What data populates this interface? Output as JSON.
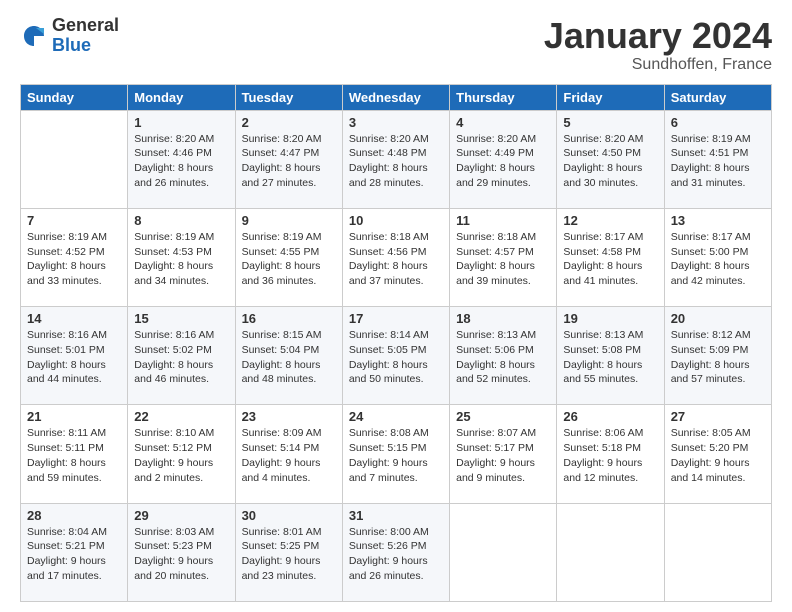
{
  "header": {
    "logo_general": "General",
    "logo_blue": "Blue",
    "title": "January 2024",
    "subtitle": "Sundhoffen, France"
  },
  "weekdays": [
    "Sunday",
    "Monday",
    "Tuesday",
    "Wednesday",
    "Thursday",
    "Friday",
    "Saturday"
  ],
  "weeks": [
    [
      {
        "day": "",
        "sunrise": "",
        "sunset": "",
        "daylight": ""
      },
      {
        "day": "1",
        "sunrise": "Sunrise: 8:20 AM",
        "sunset": "Sunset: 4:46 PM",
        "daylight": "Daylight: 8 hours and 26 minutes."
      },
      {
        "day": "2",
        "sunrise": "Sunrise: 8:20 AM",
        "sunset": "Sunset: 4:47 PM",
        "daylight": "Daylight: 8 hours and 27 minutes."
      },
      {
        "day": "3",
        "sunrise": "Sunrise: 8:20 AM",
        "sunset": "Sunset: 4:48 PM",
        "daylight": "Daylight: 8 hours and 28 minutes."
      },
      {
        "day": "4",
        "sunrise": "Sunrise: 8:20 AM",
        "sunset": "Sunset: 4:49 PM",
        "daylight": "Daylight: 8 hours and 29 minutes."
      },
      {
        "day": "5",
        "sunrise": "Sunrise: 8:20 AM",
        "sunset": "Sunset: 4:50 PM",
        "daylight": "Daylight: 8 hours and 30 minutes."
      },
      {
        "day": "6",
        "sunrise": "Sunrise: 8:19 AM",
        "sunset": "Sunset: 4:51 PM",
        "daylight": "Daylight: 8 hours and 31 minutes."
      }
    ],
    [
      {
        "day": "7",
        "sunrise": "Sunrise: 8:19 AM",
        "sunset": "Sunset: 4:52 PM",
        "daylight": "Daylight: 8 hours and 33 minutes."
      },
      {
        "day": "8",
        "sunrise": "Sunrise: 8:19 AM",
        "sunset": "Sunset: 4:53 PM",
        "daylight": "Daylight: 8 hours and 34 minutes."
      },
      {
        "day": "9",
        "sunrise": "Sunrise: 8:19 AM",
        "sunset": "Sunset: 4:55 PM",
        "daylight": "Daylight: 8 hours and 36 minutes."
      },
      {
        "day": "10",
        "sunrise": "Sunrise: 8:18 AM",
        "sunset": "Sunset: 4:56 PM",
        "daylight": "Daylight: 8 hours and 37 minutes."
      },
      {
        "day": "11",
        "sunrise": "Sunrise: 8:18 AM",
        "sunset": "Sunset: 4:57 PM",
        "daylight": "Daylight: 8 hours and 39 minutes."
      },
      {
        "day": "12",
        "sunrise": "Sunrise: 8:17 AM",
        "sunset": "Sunset: 4:58 PM",
        "daylight": "Daylight: 8 hours and 41 minutes."
      },
      {
        "day": "13",
        "sunrise": "Sunrise: 8:17 AM",
        "sunset": "Sunset: 5:00 PM",
        "daylight": "Daylight: 8 hours and 42 minutes."
      }
    ],
    [
      {
        "day": "14",
        "sunrise": "Sunrise: 8:16 AM",
        "sunset": "Sunset: 5:01 PM",
        "daylight": "Daylight: 8 hours and 44 minutes."
      },
      {
        "day": "15",
        "sunrise": "Sunrise: 8:16 AM",
        "sunset": "Sunset: 5:02 PM",
        "daylight": "Daylight: 8 hours and 46 minutes."
      },
      {
        "day": "16",
        "sunrise": "Sunrise: 8:15 AM",
        "sunset": "Sunset: 5:04 PM",
        "daylight": "Daylight: 8 hours and 48 minutes."
      },
      {
        "day": "17",
        "sunrise": "Sunrise: 8:14 AM",
        "sunset": "Sunset: 5:05 PM",
        "daylight": "Daylight: 8 hours and 50 minutes."
      },
      {
        "day": "18",
        "sunrise": "Sunrise: 8:13 AM",
        "sunset": "Sunset: 5:06 PM",
        "daylight": "Daylight: 8 hours and 52 minutes."
      },
      {
        "day": "19",
        "sunrise": "Sunrise: 8:13 AM",
        "sunset": "Sunset: 5:08 PM",
        "daylight": "Daylight: 8 hours and 55 minutes."
      },
      {
        "day": "20",
        "sunrise": "Sunrise: 8:12 AM",
        "sunset": "Sunset: 5:09 PM",
        "daylight": "Daylight: 8 hours and 57 minutes."
      }
    ],
    [
      {
        "day": "21",
        "sunrise": "Sunrise: 8:11 AM",
        "sunset": "Sunset: 5:11 PM",
        "daylight": "Daylight: 8 hours and 59 minutes."
      },
      {
        "day": "22",
        "sunrise": "Sunrise: 8:10 AM",
        "sunset": "Sunset: 5:12 PM",
        "daylight": "Daylight: 9 hours and 2 minutes."
      },
      {
        "day": "23",
        "sunrise": "Sunrise: 8:09 AM",
        "sunset": "Sunset: 5:14 PM",
        "daylight": "Daylight: 9 hours and 4 minutes."
      },
      {
        "day": "24",
        "sunrise": "Sunrise: 8:08 AM",
        "sunset": "Sunset: 5:15 PM",
        "daylight": "Daylight: 9 hours and 7 minutes."
      },
      {
        "day": "25",
        "sunrise": "Sunrise: 8:07 AM",
        "sunset": "Sunset: 5:17 PM",
        "daylight": "Daylight: 9 hours and 9 minutes."
      },
      {
        "day": "26",
        "sunrise": "Sunrise: 8:06 AM",
        "sunset": "Sunset: 5:18 PM",
        "daylight": "Daylight: 9 hours and 12 minutes."
      },
      {
        "day": "27",
        "sunrise": "Sunrise: 8:05 AM",
        "sunset": "Sunset: 5:20 PM",
        "daylight": "Daylight: 9 hours and 14 minutes."
      }
    ],
    [
      {
        "day": "28",
        "sunrise": "Sunrise: 8:04 AM",
        "sunset": "Sunset: 5:21 PM",
        "daylight": "Daylight: 9 hours and 17 minutes."
      },
      {
        "day": "29",
        "sunrise": "Sunrise: 8:03 AM",
        "sunset": "Sunset: 5:23 PM",
        "daylight": "Daylight: 9 hours and 20 minutes."
      },
      {
        "day": "30",
        "sunrise": "Sunrise: 8:01 AM",
        "sunset": "Sunset: 5:25 PM",
        "daylight": "Daylight: 9 hours and 23 minutes."
      },
      {
        "day": "31",
        "sunrise": "Sunrise: 8:00 AM",
        "sunset": "Sunset: 5:26 PM",
        "daylight": "Daylight: 9 hours and 26 minutes."
      },
      {
        "day": "",
        "sunrise": "",
        "sunset": "",
        "daylight": ""
      },
      {
        "day": "",
        "sunrise": "",
        "sunset": "",
        "daylight": ""
      },
      {
        "day": "",
        "sunrise": "",
        "sunset": "",
        "daylight": ""
      }
    ]
  ]
}
